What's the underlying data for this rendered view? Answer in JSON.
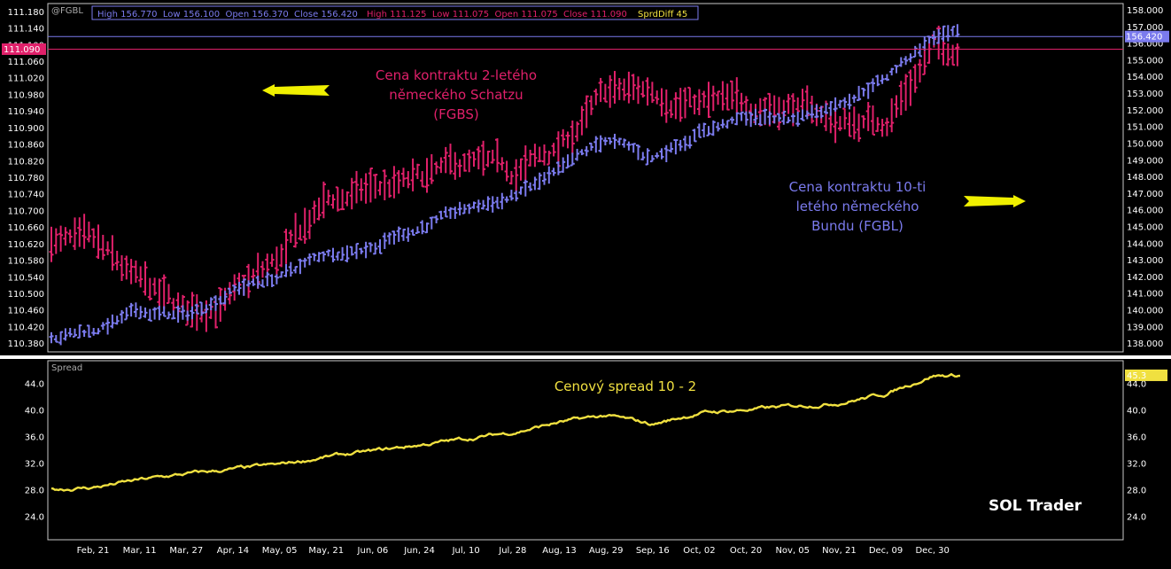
{
  "colors": {
    "fgbl": "#7b7bee",
    "fgbs": "#e0206a",
    "spread": "#f0e040",
    "header_high": "#7b7bee",
    "header_high2": "#e0206a",
    "header_spread": "#f0e040",
    "arrow": "#f0f000"
  },
  "header": {
    "symbol": "@FGBL",
    "fgbl_quote": "High 156.770  Low 156.100  Open 156.370  Close 156.420",
    "fgbs_quote": "High 111.125  Low 111.075  Open 111.075  Close 111.090",
    "spread_quote": "SprdDiff 45"
  },
  "badges": {
    "fgbl_last": "156.420",
    "fgbs_last": "111.090",
    "spread_last": "45.3"
  },
  "annotations": {
    "fgbs_label": [
      "Cena kontraktu 2-letého",
      "německého Schatzu",
      "(FGBS)"
    ],
    "fgbl_label": [
      "Cena kontraktu 10-ti",
      "letého německého",
      "Bundu (FGBL)"
    ],
    "spread_label": "Cenový spread 10 - 2",
    "brand": "SOL Trader",
    "spread_panel_title": "Spread"
  },
  "chart_data": [
    {
      "type": "bar",
      "subtype": "ohlc",
      "axis_side": "left",
      "series": [
        {
          "name": "FGBS"
        }
      ],
      "x": [
        "Feb, 21",
        "Mar, 11",
        "Mar, 27",
        "Apr, 14",
        "May, 05",
        "May, 21",
        "Jun, 06",
        "Jun, 24",
        "Jul, 10",
        "Jul, 28",
        "Aug, 13",
        "Aug, 29",
        "Sep, 16",
        "Oct, 02",
        "Oct, 20",
        "Nov, 05",
        "Nov, 21",
        "Dec, 09",
        "Dec, 30"
      ],
      "y_close_at_ticks": [
        110.61,
        110.52,
        110.45,
        110.49,
        110.58,
        110.72,
        110.75,
        110.77,
        110.81,
        110.79,
        110.85,
        110.98,
        110.99,
        110.96,
        110.95,
        110.96,
        110.91,
        110.92,
        111.09
      ],
      "yticks": [
        110.38,
        110.42,
        110.46,
        110.5,
        110.54,
        110.58,
        110.62,
        110.66,
        110.7,
        110.74,
        110.78,
        110.82,
        110.86,
        110.9,
        110.94,
        110.98,
        111.02,
        111.06,
        111.1,
        111.14,
        111.18
      ],
      "ytick_labels": [
        "110.380",
        "110.420",
        "110.460",
        "110.500",
        "110.540",
        "110.580",
        "110.620",
        "110.660",
        "110.700",
        "110.740",
        "110.780",
        "110.820",
        "110.860",
        "110.900",
        "110.940",
        "110.980",
        "111.020",
        "111.060",
        "111.100",
        "111.140",
        "111.180"
      ],
      "ylim": [
        110.36,
        111.2
      ]
    },
    {
      "type": "bar",
      "subtype": "ohlc",
      "axis_side": "right",
      "series": [
        {
          "name": "FGBL"
        }
      ],
      "x": [
        "Feb, 21",
        "Mar, 11",
        "Mar, 27",
        "Apr, 14",
        "May, 05",
        "May, 21",
        "Jun, 06",
        "Jun, 24",
        "Jul, 10",
        "Jul, 28",
        "Aug, 13",
        "Aug, 29",
        "Sep, 16",
        "Oct, 02",
        "Oct, 20",
        "Nov, 05",
        "Nov, 21",
        "Dec, 09",
        "Dec, 30"
      ],
      "y_close_at_ticks": [
        138.8,
        139.9,
        139.6,
        141.3,
        142.0,
        143.4,
        143.9,
        145.0,
        146.0,
        146.8,
        148.2,
        150.2,
        149.1,
        150.8,
        151.5,
        151.5,
        152.5,
        154.0,
        156.42
      ],
      "yticks": [
        138,
        139,
        140,
        141,
        142,
        143,
        144,
        145,
        146,
        147,
        148,
        149,
        150,
        151,
        152,
        153,
        154,
        155,
        156,
        157,
        158
      ],
      "ytick_labels": [
        "138.000",
        "139.000",
        "140.000",
        "141.000",
        "142.000",
        "143.000",
        "144.000",
        "145.000",
        "146.000",
        "147.000",
        "148.000",
        "149.000",
        "150.000",
        "151.000",
        "152.000",
        "153.000",
        "154.000",
        "155.000",
        "156.000",
        "157.000",
        "158.000"
      ],
      "ylim": [
        137.5,
        158.4
      ]
    },
    {
      "type": "line",
      "series": [
        {
          "name": "Spread"
        }
      ],
      "x": [
        "Feb, 21",
        "Mar, 11",
        "Mar, 27",
        "Apr, 14",
        "May, 05",
        "May, 21",
        "Jun, 06",
        "Jun, 24",
        "Jul, 10",
        "Jul, 28",
        "Aug, 13",
        "Aug, 29",
        "Sep, 16",
        "Oct, 02",
        "Oct, 20",
        "Nov, 05",
        "Nov, 21",
        "Dec, 09",
        "Dec, 30"
      ],
      "values": [
        28.4,
        29.5,
        30.4,
        31.1,
        31.8,
        33.0,
        33.8,
        34.8,
        35.7,
        36.7,
        38.2,
        39.2,
        37.9,
        39.6,
        40.1,
        40.6,
        41.2,
        42.5,
        45.3
      ],
      "yticks": [
        24,
        28,
        32,
        36,
        40,
        44
      ],
      "ytick_labels": [
        "24.0",
        "28.0",
        "32.0",
        "36.0",
        "40.0",
        "44.0"
      ],
      "ylim": [
        20.5,
        47.5
      ]
    }
  ]
}
